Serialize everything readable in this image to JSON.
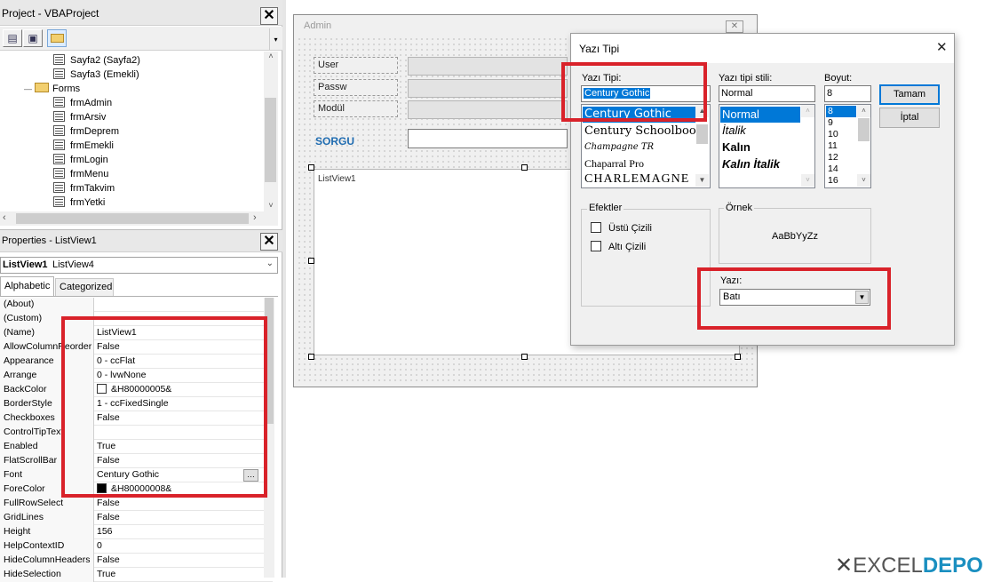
{
  "project": {
    "title": "Project - VBAProject",
    "tree": [
      {
        "label": "Sayfa2 (Sayfa2)",
        "type": "sheet"
      },
      {
        "label": "Sayfa3 (Emekli)",
        "type": "sheet"
      },
      {
        "label": "Forms",
        "type": "folder"
      },
      {
        "label": "frmAdmin",
        "type": "form"
      },
      {
        "label": "frmArsiv",
        "type": "form"
      },
      {
        "label": "frmDeprem",
        "type": "form"
      },
      {
        "label": "frmEmekli",
        "type": "form"
      },
      {
        "label": "frmLogin",
        "type": "form"
      },
      {
        "label": "frmMenu",
        "type": "form"
      },
      {
        "label": "frmTakvim",
        "type": "form"
      },
      {
        "label": "frmYetki",
        "type": "form"
      }
    ]
  },
  "properties": {
    "title": "Properties - ListView1",
    "object_name": "ListView1",
    "object_type": "ListView4",
    "tabs": [
      "Alphabetic",
      "Categorized"
    ],
    "rows": [
      {
        "name": "(About)",
        "value": ""
      },
      {
        "name": "(Custom)",
        "value": ""
      },
      {
        "name": "(Name)",
        "value": "ListView1"
      },
      {
        "name": "AllowColumnReorder",
        "value": "False"
      },
      {
        "name": "Appearance",
        "value": "0 - ccFlat"
      },
      {
        "name": "Arrange",
        "value": "0 - lvwNone"
      },
      {
        "name": "BackColor",
        "value": "&H80000005&"
      },
      {
        "name": "BorderStyle",
        "value": "1 - ccFixedSingle"
      },
      {
        "name": "Checkboxes",
        "value": "False"
      },
      {
        "name": "ControlTipText",
        "value": ""
      },
      {
        "name": "Enabled",
        "value": "True"
      },
      {
        "name": "FlatScrollBar",
        "value": "False"
      },
      {
        "name": "Font",
        "value": "Century Gothic"
      },
      {
        "name": "ForeColor",
        "value": "&H80000008&"
      },
      {
        "name": "FullRowSelect",
        "value": "False"
      },
      {
        "name": "GridLines",
        "value": "False"
      },
      {
        "name": "Height",
        "value": "156"
      },
      {
        "name": "HelpContextID",
        "value": "0"
      },
      {
        "name": "HideColumnHeaders",
        "value": "False"
      },
      {
        "name": "HideSelection",
        "value": "True"
      }
    ]
  },
  "form": {
    "title": "Admin",
    "labels": [
      "User",
      "Passw",
      "Modül"
    ],
    "sorgu_label": "SORGU",
    "listview_label": "ListView1"
  },
  "font_dialog": {
    "title": "Yazı Tipi",
    "font_label": "Yazı Tipi:",
    "font_value": "Century Gothic",
    "fonts": [
      "Century Gothic",
      "Century Schoolbook",
      "Champagne TR",
      "Chaparral Pro",
      "CHARLEMAGNE"
    ],
    "style_label": "Yazı tipi stili:",
    "style_value": "Normal",
    "styles": [
      "Normal",
      "İtalik",
      "Kalın",
      "Kalın İtalik"
    ],
    "size_label": "Boyut:",
    "size_value": "8",
    "sizes": [
      "8",
      "9",
      "10",
      "11",
      "12",
      "14",
      "16"
    ],
    "ok_button": "Tamam",
    "cancel_button": "İptal",
    "effects_label": "Efektler",
    "strikeout_label": "Üstü Çizili",
    "underline_label": "Altı Çizili",
    "sample_label": "Örnek",
    "sample_text": "AaBbYyZz",
    "script_label": "Yazı:",
    "script_value": "Batı"
  },
  "watermark": "EXCELDEPO",
  "colors": {
    "highlight": "#0078d7",
    "red_frame": "#d9222a",
    "sorgu_blue": "#1e6bb0"
  }
}
